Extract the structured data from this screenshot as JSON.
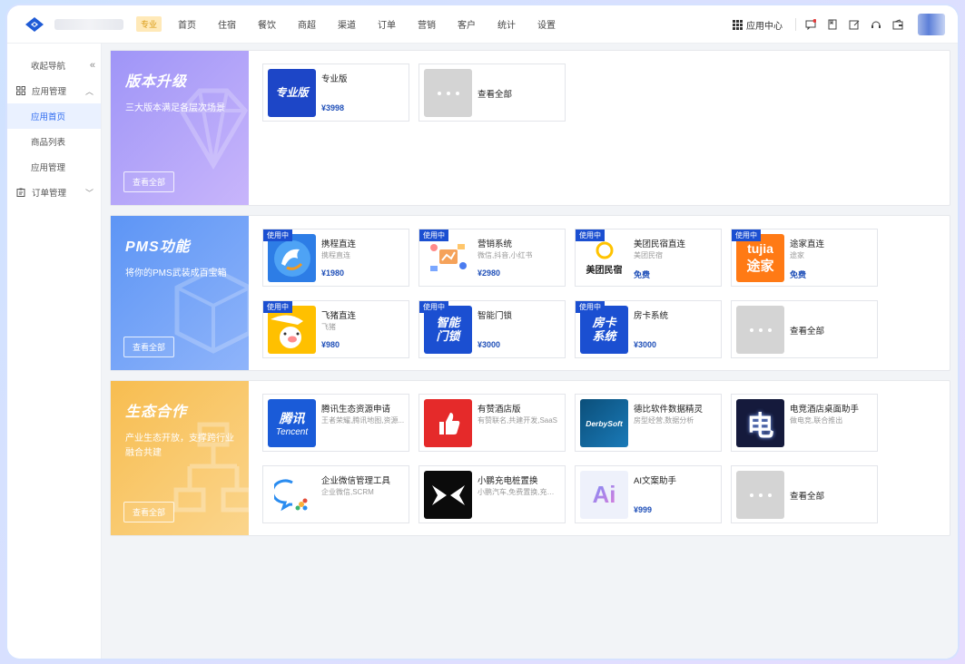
{
  "topbar": {
    "edition_tag": "专业",
    "nav": [
      "首页",
      "住宿",
      "餐饮",
      "商超",
      "渠道",
      "订单",
      "营销",
      "客户",
      "统计",
      "设置"
    ],
    "app_center": "应用中心"
  },
  "sidebar": {
    "collapse": "收起导航",
    "groups": [
      {
        "label": "应用管理",
        "items": [
          "应用首页",
          "商品列表",
          "应用管理"
        ]
      },
      {
        "label": "订单管理"
      }
    ]
  },
  "sections": [
    {
      "title": "版本升级",
      "desc": "三大版本满足各层次场景",
      "button": "查看全部",
      "cards": [
        {
          "name": "专业版",
          "price": "¥3998",
          "icon_text": "专业版"
        },
        {
          "all": "查看全部"
        }
      ]
    },
    {
      "title": "PMS功能",
      "desc": "将你的PMS武装成百宝箱",
      "button": "查看全部",
      "cards": [
        {
          "tag": "使用中",
          "name": "携程直连",
          "sub": "携程直连",
          "price": "¥1980"
        },
        {
          "tag": "使用中",
          "name": "营销系统",
          "sub": "微信,抖音,小红书",
          "price": "¥2980"
        },
        {
          "tag": "使用中",
          "name": "美团民宿直连",
          "sub": "美团民宿",
          "price": "免费",
          "icon_text": "美团民宿"
        },
        {
          "tag": "使用中",
          "name": "途家直连",
          "sub": "途家",
          "price": "免费",
          "icon_text1": "tujia",
          "icon_text2": "途家"
        },
        {
          "tag": "使用中",
          "name": "飞猪直连",
          "sub": "飞猪",
          "price": "¥980"
        },
        {
          "tag": "使用中",
          "name": "智能门锁",
          "price": "¥3000",
          "icon_text": "智能门锁"
        },
        {
          "tag": "使用中",
          "name": "房卡系统",
          "price": "¥3000",
          "icon_text": "房卡系统"
        },
        {
          "all": "查看全部"
        }
      ]
    },
    {
      "title": "生态合作",
      "desc": "产业生态开放，支撑跨行业融合共建",
      "button": "查看全部",
      "cards": [
        {
          "name": "腾讯生态资源申请",
          "sub": "王者荣耀,腾讯地图,资源...",
          "icon_text1": "腾讯",
          "icon_text2": "Tencent"
        },
        {
          "name": "有赞酒店版",
          "sub": "有赞联名,共建开发,SaaS"
        },
        {
          "name": "德比软件数据精灵",
          "sub": "房型经营,数据分析",
          "icon_text": "DerbySoft"
        },
        {
          "name": "电竞酒店桌面助手",
          "sub": "做电竞,联合推出",
          "icon_text": "电"
        },
        {
          "name": "企业微信管理工具",
          "sub": "企业微信,SCRM"
        },
        {
          "name": "小鹏充电桩置换",
          "sub": "小鹏汽车,免费置换,充电桩"
        },
        {
          "name": "AI文案助手",
          "price": "¥999",
          "icon_text": "Ai"
        },
        {
          "all": "查看全部"
        }
      ]
    }
  ]
}
